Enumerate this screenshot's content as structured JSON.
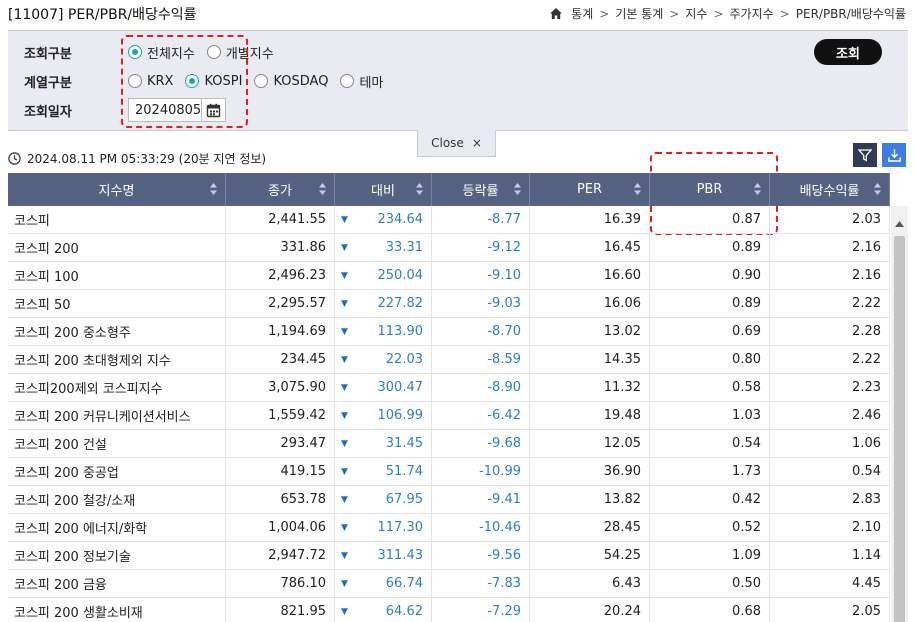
{
  "header": {
    "title": "[11007] PER/PBR/배당수익률",
    "breadcrumb": [
      "통계",
      "기본 통계",
      "지수",
      "주가지수",
      "PER/PBR/배당수익률"
    ]
  },
  "search": {
    "query_type_label": "조회구분",
    "query_type_options": [
      {
        "label": "전체지수",
        "selected": true
      },
      {
        "label": "개별지수",
        "selected": false
      }
    ],
    "series_label": "계열구분",
    "series_options": [
      {
        "label": "KRX",
        "selected": false
      },
      {
        "label": "KOSPI",
        "selected": true
      },
      {
        "label": "KOSDAQ",
        "selected": false
      },
      {
        "label": "테마",
        "selected": false
      }
    ],
    "date_label": "조회일자",
    "date_value": "20240805",
    "search_button": "조회",
    "close_label": "Close",
    "close_icon": "×"
  },
  "info": {
    "timestamp": "2024.08.11 PM 05:33:29 (20분 지연 정보)"
  },
  "table": {
    "columns": [
      "지수명",
      "종가",
      "대비",
      "등락률",
      "PER",
      "PBR",
      "배당수익률"
    ],
    "change_icon": "▼",
    "rows": [
      {
        "name": "코스피",
        "close": "2,441.55",
        "change": "234.64",
        "rate": "-8.77",
        "per": "16.39",
        "pbr": "0.87",
        "div": "2.03"
      },
      {
        "name": "코스피 200",
        "close": "331.86",
        "change": "33.31",
        "rate": "-9.12",
        "per": "16.45",
        "pbr": "0.89",
        "div": "2.16"
      },
      {
        "name": "코스피 100",
        "close": "2,496.23",
        "change": "250.04",
        "rate": "-9.10",
        "per": "16.60",
        "pbr": "0.90",
        "div": "2.16"
      },
      {
        "name": "코스피 50",
        "close": "2,295.57",
        "change": "227.82",
        "rate": "-9.03",
        "per": "16.06",
        "pbr": "0.89",
        "div": "2.22"
      },
      {
        "name": "코스피 200 중소형주",
        "close": "1,194.69",
        "change": "113.90",
        "rate": "-8.70",
        "per": "13.02",
        "pbr": "0.69",
        "div": "2.28"
      },
      {
        "name": "코스피 200 초대형제외 지수",
        "close": "234.45",
        "change": "22.03",
        "rate": "-8.59",
        "per": "14.35",
        "pbr": "0.80",
        "div": "2.22"
      },
      {
        "name": "코스피200제외 코스피지수",
        "close": "3,075.90",
        "change": "300.47",
        "rate": "-8.90",
        "per": "11.32",
        "pbr": "0.58",
        "div": "2.23"
      },
      {
        "name": "코스피 200 커뮤니케이션서비스",
        "close": "1,559.42",
        "change": "106.99",
        "rate": "-6.42",
        "per": "19.48",
        "pbr": "1.03",
        "div": "2.46"
      },
      {
        "name": "코스피 200 건설",
        "close": "293.47",
        "change": "31.45",
        "rate": "-9.68",
        "per": "12.05",
        "pbr": "0.54",
        "div": "1.06"
      },
      {
        "name": "코스피 200 중공업",
        "close": "419.15",
        "change": "51.74",
        "rate": "-10.99",
        "per": "36.90",
        "pbr": "1.73",
        "div": "0.54"
      },
      {
        "name": "코스피 200 철강/소재",
        "close": "653.78",
        "change": "67.95",
        "rate": "-9.41",
        "per": "13.82",
        "pbr": "0.42",
        "div": "2.83"
      },
      {
        "name": "코스피 200 에너지/화학",
        "close": "1,004.06",
        "change": "117.30",
        "rate": "-10.46",
        "per": "28.45",
        "pbr": "0.52",
        "div": "2.10"
      },
      {
        "name": "코스피 200 정보기술",
        "close": "2,947.72",
        "change": "311.43",
        "rate": "-9.56",
        "per": "54.25",
        "pbr": "1.09",
        "div": "1.14"
      },
      {
        "name": "코스피 200 금융",
        "close": "786.10",
        "change": "66.74",
        "rate": "-7.83",
        "per": "6.43",
        "pbr": "0.50",
        "div": "4.45"
      },
      {
        "name": "코스피 200 생활소비재",
        "close": "821.95",
        "change": "64.62",
        "rate": "-7.29",
        "per": "20.24",
        "pbr": "0.68",
        "div": "2.05"
      }
    ]
  },
  "colors": {
    "header_bg": "#566281",
    "panel_bg": "#e9eaf2",
    "accent": "#1aa7b4",
    "negative_blue": "#2b7fd0",
    "highlight_red": "#e02020"
  }
}
